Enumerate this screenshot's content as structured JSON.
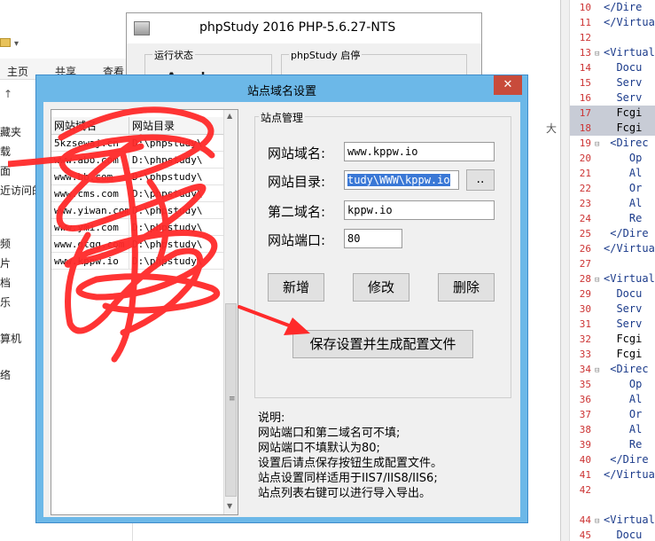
{
  "explorer": {
    "ribbon_tabs": [
      "主页",
      "共享",
      "查看"
    ],
    "nav_items": [
      "藏夹",
      "载",
      "面",
      "近访问的",
      "频",
      "片",
      "档",
      "乐",
      "算机",
      "络"
    ]
  },
  "php_window": {
    "title": "phpStudy 2016   PHP-5.6.27-NTS",
    "group_status": "运行状态",
    "group_start": "phpStudy 启停",
    "apache_label": "Apache"
  },
  "dialog": {
    "title": "站点域名设置",
    "close_label": "✕",
    "list": {
      "headers": [
        "网站域名",
        "网站目录"
      ],
      "rows": [
        [
          "5kzsewaj.cn",
          "D:\\phpstudy\\"
        ],
        [
          "www.abo.com",
          "D:\\phpstudy\\"
        ],
        [
          "www.bb.com",
          "D:\\phpstudy\\"
        ],
        [
          "www.cms.com",
          "D:\\phpstudy\\"
        ],
        [
          "www.yiwan.com",
          "D:\\phpstudy\\"
        ],
        [
          "www.ymi.com",
          "D:\\phpstudy\\"
        ],
        [
          "www.gtgg.com",
          "D:\\phpstudy\\"
        ],
        [
          "www.kppw.io",
          "D:\\phpstudy\\"
        ]
      ]
    },
    "form": {
      "group_label": "站点管理",
      "domain_label": "网站域名:",
      "domain_value": "www.kppw.io",
      "dir_label": "网站目录:",
      "dir_value": "tudy\\WWW\\kppw.io",
      "browse_label": "..",
      "second_label": "第二域名:",
      "second_value": "kppw.io",
      "port_label": "网站端口:",
      "port_value": "80",
      "add_label": "新增",
      "edit_label": "修改",
      "delete_label": "删除",
      "save_label": "保存设置并生成配置文件"
    },
    "notes": [
      "说明:",
      "网站端口和第二域名可不填;",
      "网站端口不填默认为80;",
      "设置后请点保存按钮生成配置文件。",
      "站点设置同样适用于IIS7/IIS8/IIS6;",
      "站点列表右键可以进行导入导出。"
    ]
  },
  "editor": {
    "lines": [
      {
        "n": "10",
        "code": "</Dire",
        "hl": false,
        "fold": ""
      },
      {
        "n": "11",
        "code": "</Virtua",
        "hl": false,
        "fold": ""
      },
      {
        "n": "12",
        "code": "",
        "hl": false,
        "fold": ""
      },
      {
        "n": "13",
        "code": "<Virtual",
        "hl": false,
        "fold": "⊟"
      },
      {
        "n": "14",
        "code": "  Docu",
        "hl": false,
        "fold": ""
      },
      {
        "n": "15",
        "code": "  Serv",
        "hl": false,
        "fold": ""
      },
      {
        "n": "16",
        "code": "  Serv",
        "hl": false,
        "fold": ""
      },
      {
        "n": "17",
        "code": "  Fcgi",
        "hl": true,
        "fold": ""
      },
      {
        "n": "18",
        "code": "  Fcgi",
        "hl": true,
        "fold": ""
      },
      {
        "n": "19",
        "code": " <Direc",
        "hl": false,
        "fold": "⊟"
      },
      {
        "n": "20",
        "code": "    Op",
        "hl": false,
        "fold": ""
      },
      {
        "n": "21",
        "code": "    Al",
        "hl": false,
        "fold": ""
      },
      {
        "n": "22",
        "code": "    Or",
        "hl": false,
        "fold": ""
      },
      {
        "n": "23",
        "code": "    Al",
        "hl": false,
        "fold": ""
      },
      {
        "n": "24",
        "code": "    Re",
        "hl": false,
        "fold": ""
      },
      {
        "n": "25",
        "code": " </Dire",
        "hl": false,
        "fold": ""
      },
      {
        "n": "26",
        "code": "</Virtua",
        "hl": false,
        "fold": ""
      },
      {
        "n": "27",
        "code": "",
        "hl": false,
        "fold": ""
      },
      {
        "n": "28",
        "code": "<Virtual",
        "hl": false,
        "fold": "⊟"
      },
      {
        "n": "29",
        "code": "  Docu",
        "hl": false,
        "fold": ""
      },
      {
        "n": "30",
        "code": "  Serv",
        "hl": false,
        "fold": ""
      },
      {
        "n": "31",
        "code": "  Serv",
        "hl": false,
        "fold": ""
      },
      {
        "n": "32",
        "code": "  Fcgi",
        "hl": false,
        "fold": ""
      },
      {
        "n": "33",
        "code": "  Fcgi",
        "hl": false,
        "fold": ""
      },
      {
        "n": "34",
        "code": " <Direc",
        "hl": false,
        "fold": "⊟"
      },
      {
        "n": "35",
        "code": "    Op",
        "hl": false,
        "fold": ""
      },
      {
        "n": "36",
        "code": "    Al",
        "hl": false,
        "fold": ""
      },
      {
        "n": "37",
        "code": "    Or",
        "hl": false,
        "fold": ""
      },
      {
        "n": "38",
        "code": "    Al",
        "hl": false,
        "fold": ""
      },
      {
        "n": "39",
        "code": "    Re",
        "hl": false,
        "fold": ""
      },
      {
        "n": "40",
        "code": " </Dire",
        "hl": false,
        "fold": ""
      },
      {
        "n": "41",
        "code": "</Virtua",
        "hl": false,
        "fold": ""
      },
      {
        "n": "42",
        "code": "",
        "hl": false,
        "fold": ""
      },
      {
        "n": "44",
        "code": "<Virtual",
        "hl": false,
        "fold": "⊟"
      },
      {
        "n": "45",
        "code": "  Docu",
        "hl": false,
        "fold": ""
      }
    ]
  },
  "colors": {
    "dialog_frame": "#6cb8e8",
    "close_button": "#c84b3b",
    "scribble": "#ff2a2a",
    "selection": "#3a78d6"
  }
}
